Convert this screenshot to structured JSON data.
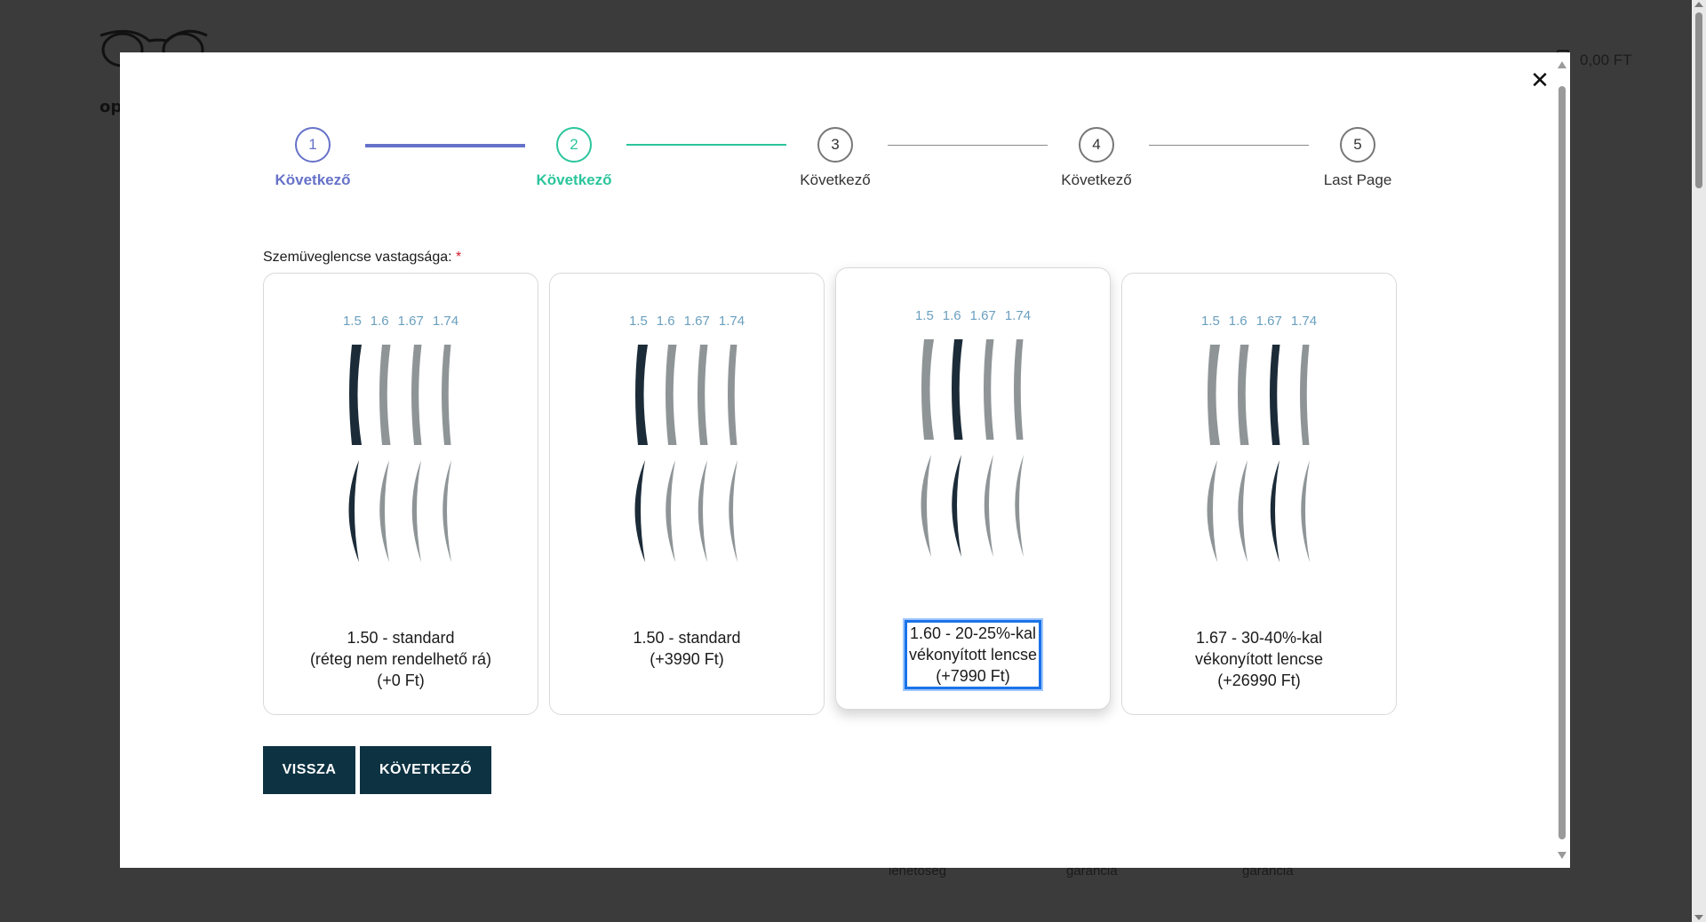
{
  "background": {
    "logo_text": "op",
    "cart_total": "0,00 FT",
    "footer_items": [
      "lehetőség",
      "garancia",
      "garancia"
    ]
  },
  "stepper": {
    "steps": [
      {
        "number": "1",
        "label": "Következő",
        "state": "done"
      },
      {
        "number": "2",
        "label": "Következő",
        "state": "active"
      },
      {
        "number": "3",
        "label": "Következő",
        "state": "pending"
      },
      {
        "number": "4",
        "label": "Következő",
        "state": "pending"
      },
      {
        "number": "5",
        "label": "Last Page",
        "state": "pending"
      }
    ]
  },
  "form": {
    "field_label": "Szemüveglencse vastagsága:",
    "required_mark": "*",
    "index_labels": [
      "1.5",
      "1.6",
      "1.67",
      "1.74"
    ],
    "options": [
      {
        "caption_lines": [
          "1.50 - standard",
          "(réteg nem rendelhető rá)",
          "(+0 Ft)"
        ],
        "highlight_index": 0,
        "selected": false
      },
      {
        "caption_lines": [
          "1.50 - standard",
          "(+3990 Ft)"
        ],
        "highlight_index": 0,
        "selected": false
      },
      {
        "caption_lines": [
          "1.60 - 20-25%-kal",
          "vékonyított lencse",
          "(+7990 Ft)"
        ],
        "highlight_index": 1,
        "selected": true
      },
      {
        "caption_lines": [
          "1.67 - 30-40%-kal",
          "vékonyított lencse",
          "(+26990 Ft)"
        ],
        "highlight_index": 2,
        "selected": false
      }
    ]
  },
  "buttons": {
    "back_label": "VISSZA",
    "next_label": "KÖVETKEZŐ"
  },
  "colors": {
    "done": "#6672c9",
    "active": "#2bc59c",
    "button_bg": "#0d3242",
    "lens_dark": "#1c2b38",
    "lens_grey": "#8f9597"
  }
}
